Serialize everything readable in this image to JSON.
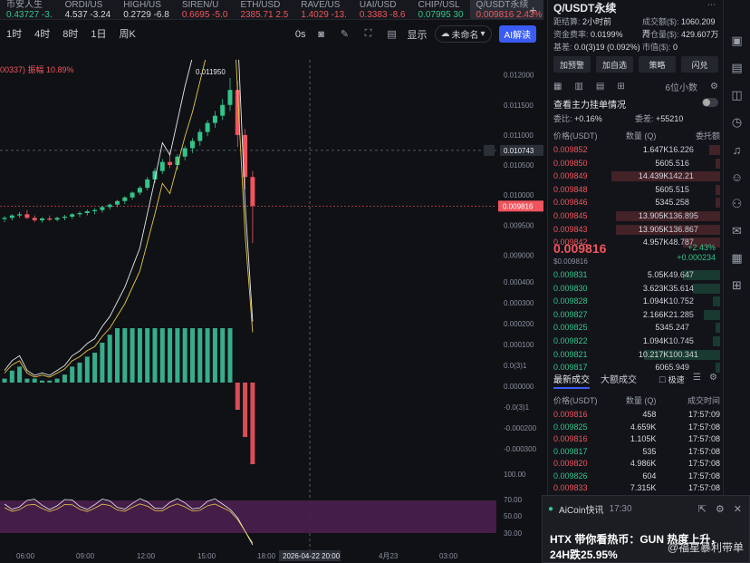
{
  "ticker": [
    {
      "name": "币安人生",
      "value": "0.43727",
      "change": "-3.",
      "color": "g"
    },
    {
      "name": "ORDI/US",
      "value": "4.537",
      "change": "-3.24",
      "color": "w"
    },
    {
      "name": "HIGH/US",
      "value": "0.2729",
      "change": "-6.8",
      "color": "w"
    },
    {
      "name": "SIREN/U",
      "value": "0.6695",
      "change": "-5.0",
      "color": "r"
    },
    {
      "name": "ETH/USD",
      "value": "2385.71",
      "change": "2.5",
      "color": "r"
    },
    {
      "name": "RAVE/US",
      "value": "1.4029",
      "change": "-13.",
      "color": "r"
    },
    {
      "name": "UAI/USD",
      "value": "0.3383",
      "change": "-8.6",
      "color": "r"
    },
    {
      "name": "CHIP/USL",
      "value": "0.07995",
      "change": "30",
      "color": "g"
    },
    {
      "name": "Q/USDT永续",
      "value": "0.009816",
      "change": "2.43%",
      "color": "r"
    }
  ],
  "toolbar": {
    "intervals": [
      "1时",
      "4时",
      "8时",
      "1日",
      "周K"
    ],
    "seconds": "0s",
    "display": "显示",
    "unnamed": "未命名",
    "ai": "AI解读"
  },
  "indicator_label": "00337) 振幅 10.89%",
  "chart_data": {
    "type": "line",
    "price_labels": [
      "0.012000",
      "0.011500",
      "0.011000",
      "0.010500",
      "0.010000",
      "0.009500",
      "0.009000"
    ],
    "price_range": [
      0.0089,
      0.0121
    ],
    "crosshair_price": "0.010743",
    "last_price": "0.009816",
    "peak_label": "0.011950",
    "peak_price": 0.01195,
    "macd_labels": [
      "0.000400",
      "0.000300",
      "0.000200",
      "0.000100",
      "0.0(3)1",
      "0.000000",
      "-0.0(3)1",
      "-0.000200",
      "-0.000300"
    ],
    "rsi_labels": [
      "100.00",
      "70.00",
      "50.00",
      "30.00"
    ],
    "time_labels": [
      "06:00",
      "09:00",
      "12:00",
      "15:00",
      "18:00",
      "4月23",
      "03:00"
    ],
    "crosshair_time": "2026-04-22 20:00",
    "candles": [
      [
        0.0096,
        0.00965,
        0.00955,
        0.00962
      ],
      [
        0.00962,
        0.00968,
        0.00958,
        0.00966
      ],
      [
        0.00966,
        0.00972,
        0.00962,
        0.00968
      ],
      [
        0.00968,
        0.00975,
        0.0096,
        0.00962
      ],
      [
        0.00962,
        0.00966,
        0.00955,
        0.00958
      ],
      [
        0.00958,
        0.00963,
        0.00954,
        0.00961
      ],
      [
        0.00961,
        0.00966,
        0.00957,
        0.00959
      ],
      [
        0.00959,
        0.00964,
        0.00956,
        0.00962
      ],
      [
        0.00962,
        0.00967,
        0.00958,
        0.00964
      ],
      [
        0.00964,
        0.0097,
        0.0096,
        0.00968
      ],
      [
        0.00968,
        0.00973,
        0.00963,
        0.0097
      ],
      [
        0.0097,
        0.00976,
        0.00966,
        0.00973
      ],
      [
        0.00973,
        0.00978,
        0.00968,
        0.00975
      ],
      [
        0.00975,
        0.00982,
        0.00971,
        0.0098
      ],
      [
        0.0098,
        0.00986,
        0.00976,
        0.00984
      ],
      [
        0.00984,
        0.00992,
        0.0098,
        0.0099
      ],
      [
        0.0099,
        0.00998,
        0.00985,
        0.00996
      ],
      [
        0.00996,
        0.01006,
        0.00992,
        0.01004
      ],
      [
        0.01004,
        0.01015,
        0.01,
        0.01012
      ],
      [
        0.01012,
        0.0103,
        0.01008,
        0.01026
      ],
      [
        0.01026,
        0.01045,
        0.0102,
        0.0104
      ],
      [
        0.0104,
        0.0106,
        0.01035,
        0.01055
      ],
      [
        0.01055,
        0.01072,
        0.01045,
        0.0105
      ],
      [
        0.0105,
        0.01068,
        0.01042,
        0.01064
      ],
      [
        0.01064,
        0.01082,
        0.01058,
        0.01078
      ],
      [
        0.01078,
        0.01095,
        0.0107,
        0.0109
      ],
      [
        0.0109,
        0.0111,
        0.01082,
        0.01105
      ],
      [
        0.01105,
        0.01125,
        0.01098,
        0.0112
      ],
      [
        0.0112,
        0.0114,
        0.01112,
        0.01132
      ],
      [
        0.01132,
        0.0116,
        0.01125,
        0.0115
      ],
      [
        0.0115,
        0.01195,
        0.0114,
        0.01175
      ],
      [
        0.01175,
        0.0119,
        0.0108,
        0.011
      ],
      [
        0.011,
        0.0111,
        0.0101,
        0.0103
      ],
      [
        0.0103,
        0.0104,
        0.0092,
        0.00982
      ]
    ]
  },
  "panel": {
    "title": "Q/USDT永续",
    "stats": [
      {
        "label": "距结算",
        "value": "2小时前"
      },
      {
        "label": "成交额($)",
        "value": "1060.209万"
      },
      {
        "label": "资金费率",
        "value": "0.0199%"
      },
      {
        "label": "持仓量($)",
        "value": "429.607万"
      },
      {
        "label": "基差",
        "value": "0.0(3)19 (0.092%)"
      },
      {
        "label": "市值($)",
        "value": "0"
      }
    ],
    "buttons": [
      "加预警",
      "加自选",
      "策略",
      "闪兑"
    ],
    "decimal": "6位小数",
    "depth_title": "查看主力挂单情况",
    "ratio_label": "委比:",
    "ratio_value": "+0.16%",
    "diff_label": "委差:",
    "diff_value": "+55210",
    "ob_headers": [
      "价格(USDT)",
      "数量 (Q)",
      "委托额"
    ],
    "asks": [
      [
        "0.009852",
        "1.647K",
        "16.226",
        0.1
      ],
      [
        "0.009850",
        "560",
        "5.516",
        0.04
      ],
      [
        "0.009849",
        "14.439K",
        "142.21",
        1.0
      ],
      [
        "0.009848",
        "560",
        "5.515",
        0.04
      ],
      [
        "0.009846",
        "534",
        "5.258",
        0.04
      ],
      [
        "0.009845",
        "13.905K",
        "136.895",
        0.96
      ],
      [
        "0.009843",
        "13.905K",
        "136.867",
        0.96
      ],
      [
        "0.009842",
        "4.957K",
        "48.787",
        0.34
      ]
    ],
    "mid_price": "0.009816",
    "mid_sub": "$0.009816",
    "mid_pct": "+2.43%",
    "mid_diff": "+0.000234",
    "bids": [
      [
        "0.009831",
        "5.05K",
        "49.647",
        0.34
      ],
      [
        "0.009830",
        "3.623K",
        "35.614",
        0.25
      ],
      [
        "0.009828",
        "1.094K",
        "10.752",
        0.07
      ],
      [
        "0.009827",
        "2.166K",
        "21.285",
        0.15
      ],
      [
        "0.009825",
        "534",
        "5.247",
        0.04
      ],
      [
        "0.009822",
        "1.094K",
        "10.745",
        0.07
      ],
      [
        "0.009821",
        "10.217K",
        "100.341",
        0.7
      ],
      [
        "0.009817",
        "606",
        "5.949",
        0.04
      ]
    ],
    "trade_tabs": [
      "最新成交",
      "大额成交"
    ],
    "fast_label": "极速",
    "trade_headers": [
      "价格(USDT)",
      "数量 (Q)",
      "成交时间"
    ],
    "trades": [
      [
        "0.009816",
        "458",
        "17:57:09"
      ],
      [
        "0.009825",
        "4.659K",
        "17:57:08"
      ],
      [
        "0.009816",
        "1.105K",
        "17:57:08"
      ],
      [
        "0.009817",
        "535",
        "17:57:08"
      ],
      [
        "0.009820",
        "4.986K",
        "17:57:08"
      ],
      [
        "0.009826",
        "604",
        "17:57:08"
      ],
      [
        "0.009833",
        "7.315K",
        "17:57:08"
      ]
    ]
  },
  "notification": {
    "source": "AiCoin快讯",
    "time": "17:30",
    "title": "HTX 带你看热币：GUN 热度上升，24H跌25.95%",
    "watermark": "@福星暴利带单"
  },
  "colors": {
    "up": "#33c48a",
    "down": "#f0555e",
    "accent": "#3a5cf5"
  }
}
